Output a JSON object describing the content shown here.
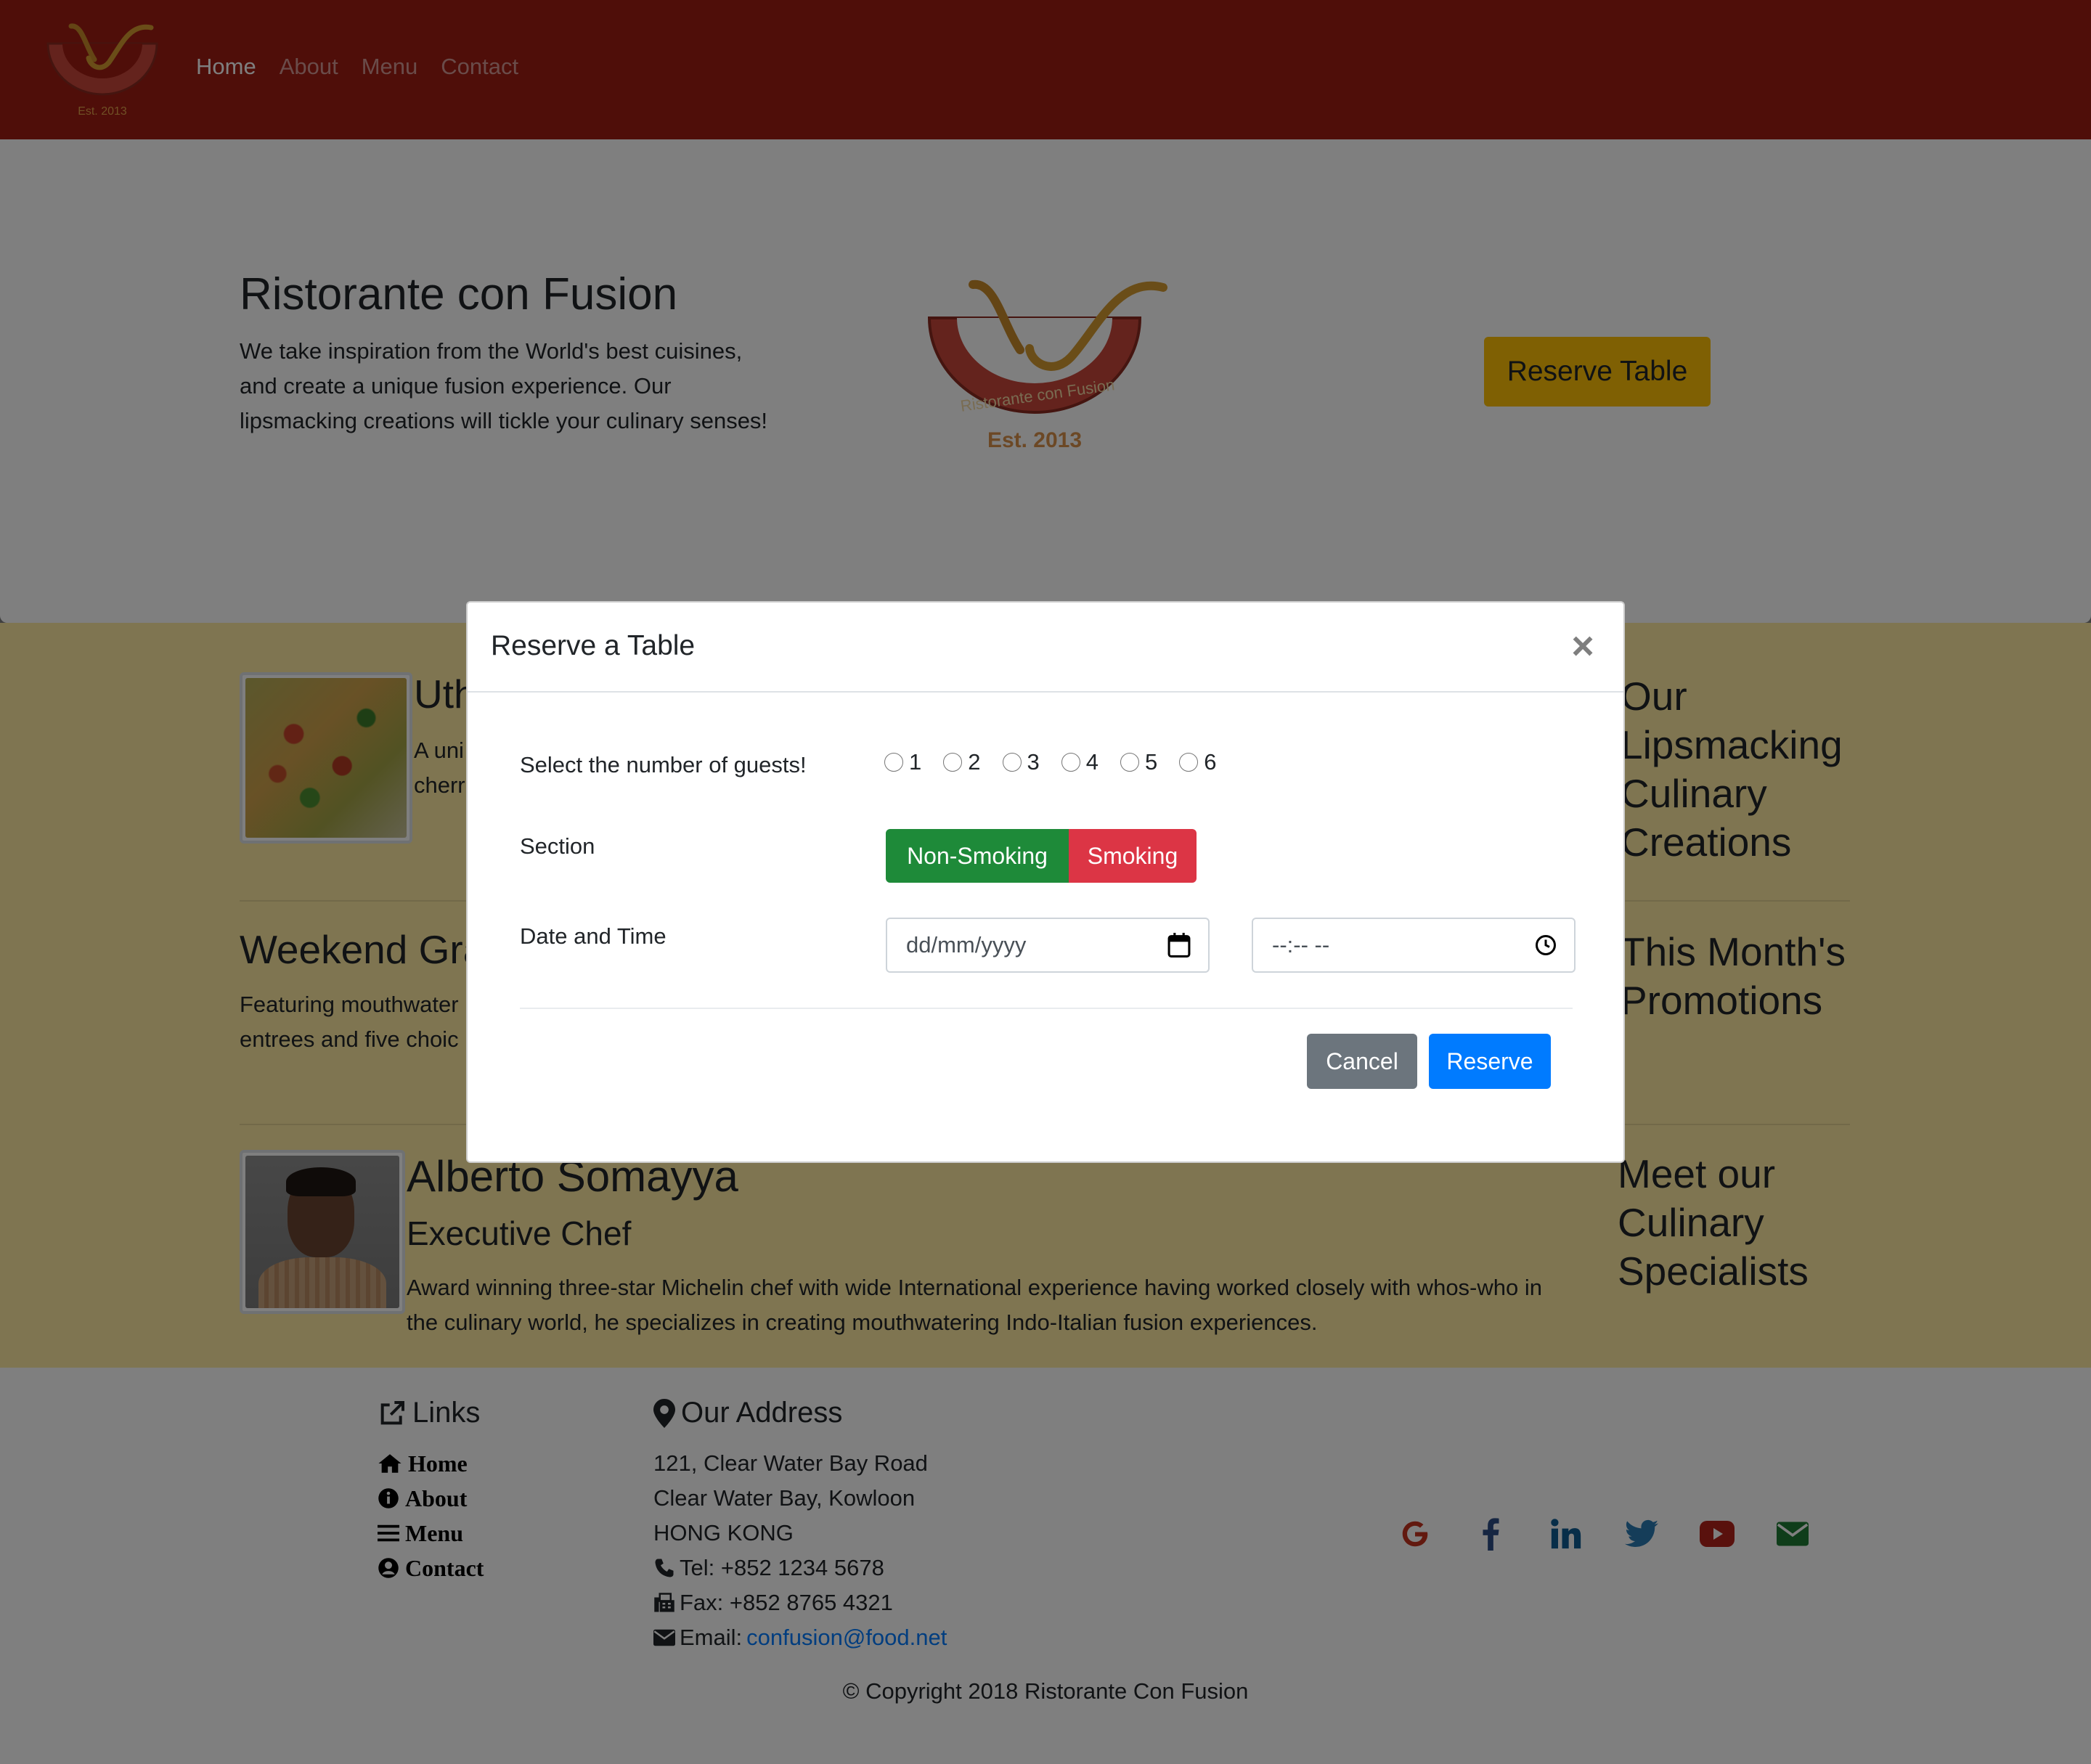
{
  "navbar": {
    "brand_logo_text": "Ristorante con Fusion",
    "brand_logo_est": "Est. 2013",
    "links": [
      {
        "label": "Home"
      },
      {
        "label": "About"
      },
      {
        "label": "Menu"
      },
      {
        "label": "Contact"
      }
    ]
  },
  "jumbotron": {
    "title": "Ristorante con Fusion",
    "text": "We take inspiration from the World's best cuisines, and create a unique fusion experience. Our lipsmacking creations will tickle your culinary senses!",
    "logo_text": "Ristorante con Fusion",
    "logo_est": "Est. 2013",
    "reserve_button": "Reserve Table"
  },
  "content": {
    "dish": {
      "title": "Uth",
      "text_line1": "A uni",
      "text_line2": "cherr"
    },
    "promo": {
      "title": "Weekend Gra",
      "text_line1": "Featuring mouthwater",
      "text_line2": "entrees and five choic"
    },
    "chef": {
      "name": "Alberto Somayya",
      "designation": "Executive Chef",
      "text": "Award winning three-star Michelin chef with wide International experience having worked closely with whos-who in the culinary world, he specializes in creating mouthwatering Indo-Italian fusion experiences."
    },
    "side_titles": [
      "Our Lipsmacking Culinary Creations",
      "This Month's Promotions",
      "Meet our Culinary Specialists"
    ]
  },
  "footer": {
    "links_title": "Links",
    "links": [
      "Home",
      "About",
      "Menu",
      "Contact"
    ],
    "address_title": "Our Address",
    "address": [
      "121, Clear Water Bay Road",
      "Clear Water Bay, Kowloon",
      "HONG KONG"
    ],
    "tel": "Tel: +852 1234 5678",
    "fax": "Fax: +852 8765 4321",
    "email_label": "Email: ",
    "email": "confusion@food.net",
    "copyright": "© Copyright 2018 Ristorante Con Fusion",
    "social_icons": [
      "google-icon",
      "facebook-icon",
      "linkedin-icon",
      "twitter-icon",
      "youtube-icon",
      "envelope-icon"
    ]
  },
  "modal": {
    "title": "Reserve a Table",
    "close": "×",
    "guests_label": "Select the number of guests!",
    "guest_options": [
      "1",
      "2",
      "3",
      "4",
      "5",
      "6"
    ],
    "section_label": "Section",
    "section_options": [
      "Non-Smoking",
      "Smoking"
    ],
    "datetime_label": "Date and Time",
    "date_placeholder": "dd/mm/yyyy",
    "time_placeholder": "--:-- --",
    "cancel": "Cancel",
    "reserve": "Reserve"
  },
  "colors": {
    "navbar": "#9f1c12",
    "content_bg": "#ffeba3",
    "warning": "#ffc107",
    "success": "#1e8a39",
    "danger": "#dc3545",
    "primary": "#007bff",
    "secondary": "#6c757d"
  }
}
